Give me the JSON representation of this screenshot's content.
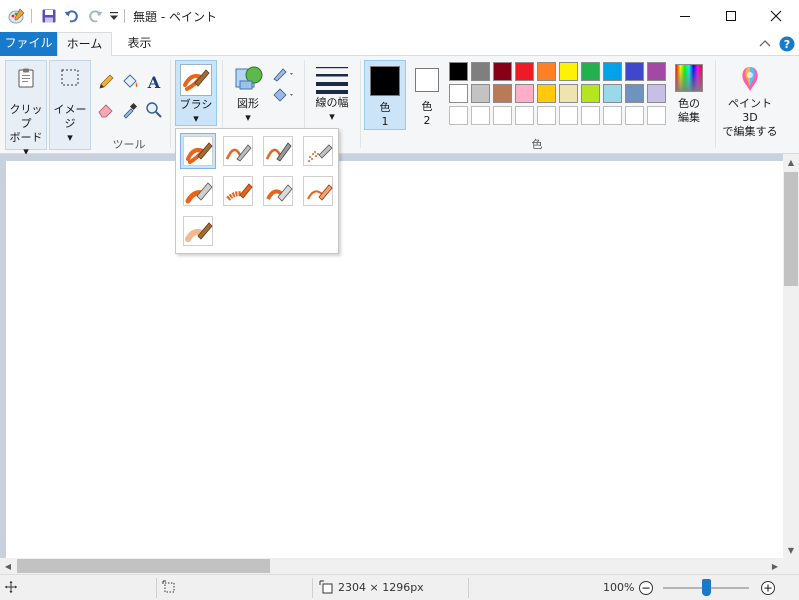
{
  "window": {
    "title": "無題 - ペイント"
  },
  "tabs": {
    "file": "ファイル",
    "home": "ホーム",
    "view": "表示"
  },
  "ribbon": {
    "clipboard_label_line1": "クリップ",
    "clipboard_label_line2": "ボード",
    "image_label": "イメージ",
    "tools_group_label": "ツール",
    "brush_label": "ブラシ",
    "shapes_label": "図形",
    "line_width_label": "線の幅",
    "color1_label_line1": "色",
    "color1_label_line2": "1",
    "color2_label_line1": "色",
    "color2_label_line2": "2",
    "edit_colors_line1": "色の",
    "edit_colors_line2": "編集",
    "paint3d_line1": "ペイント 3D",
    "paint3d_line2": "で編集する",
    "colors_group_label": "色",
    "palette_row1": [
      "#000000",
      "#7f7f7f",
      "#880015",
      "#ed1c24",
      "#ff7f27",
      "#fff200",
      "#22b14c",
      "#00a2e8",
      "#3f48cc",
      "#a349a4"
    ],
    "palette_row2": [
      "#ffffff",
      "#c3c3c3",
      "#b97a57",
      "#ffaec9",
      "#ffc90e",
      "#efe4b0",
      "#b5e61d",
      "#99d9ea",
      "#7092be",
      "#c8bfe7"
    ]
  },
  "colors": {
    "accent": "#1979ca",
    "color1": "#000000",
    "color2": "#ffffff",
    "brush_orange": "#e8641b"
  },
  "status": {
    "canvas_size": "2304 × 1296px",
    "zoom": "100%",
    "zoom_fraction": 0.5
  }
}
